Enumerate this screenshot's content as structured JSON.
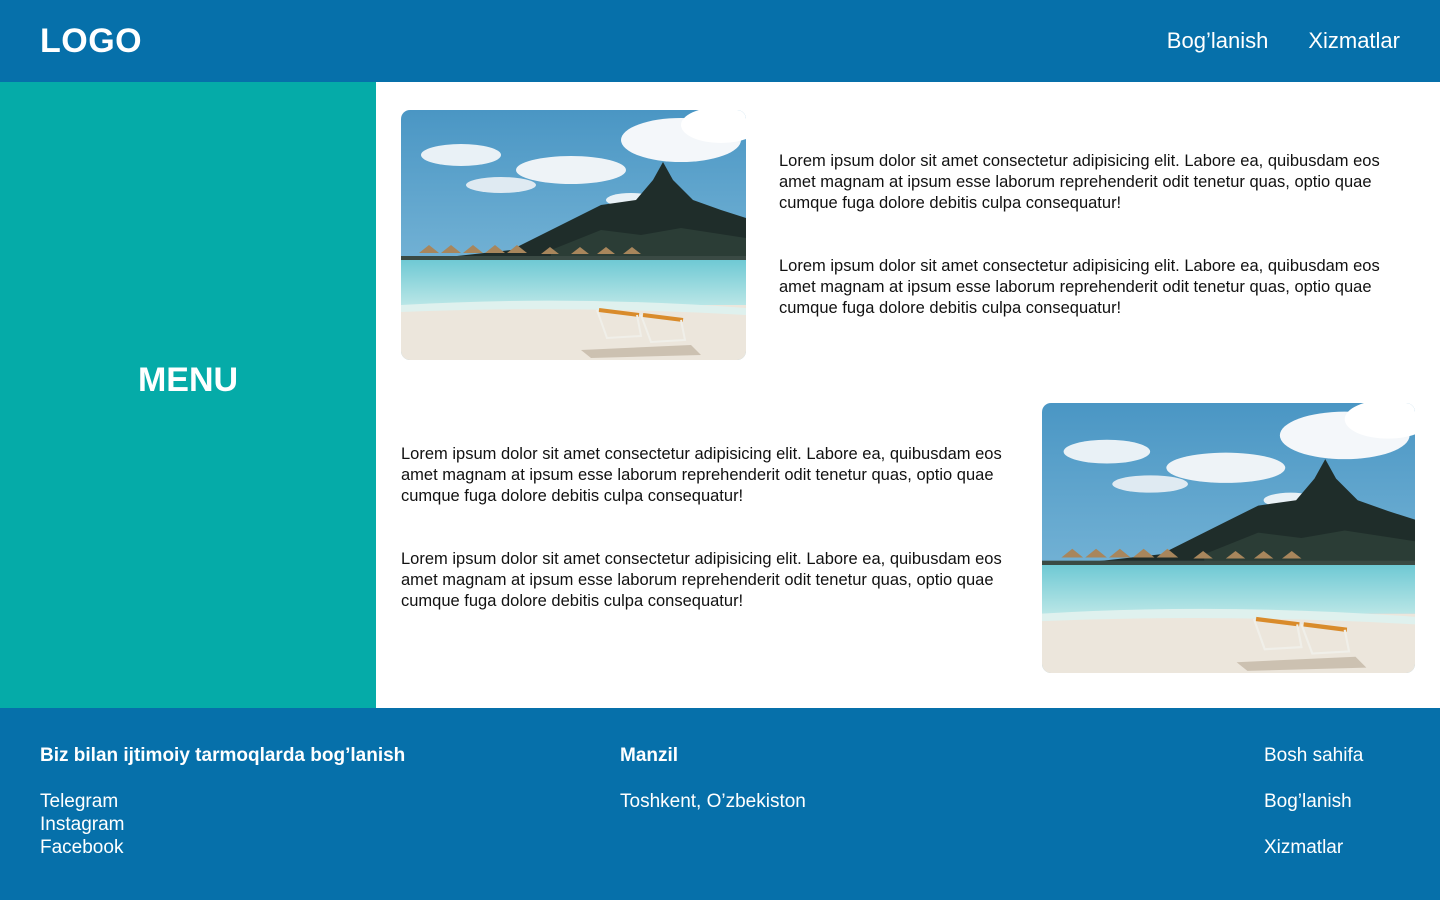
{
  "header": {
    "logo": "LOGO",
    "nav": [
      "Bog’lanish",
      "Xizmatlar"
    ]
  },
  "sidebar": {
    "label": "MENU"
  },
  "main": {
    "section1": {
      "paragraphs": [
        "Lorem ipsum dolor sit amet consectetur adipisicing elit. Labore ea, quibusdam eos amet magnam at ipsum esse laborum reprehenderit odit tenetur quas, optio quae cumque fuga dolore debitis culpa consequatur!",
        "Lorem ipsum dolor sit amet consectetur adipisicing elit. Labore ea, quibusdam eos amet magnam at ipsum esse laborum reprehenderit odit tenetur quas, optio quae cumque fuga dolore debitis culpa consequatur!"
      ]
    },
    "section2": {
      "paragraphs": [
        "Lorem ipsum dolor sit amet consectetur adipisicing elit. Labore ea, quibusdam eos amet magnam at ipsum esse laborum reprehenderit odit tenetur quas, optio quae cumque fuga dolore debitis culpa consequatur!",
        "Lorem ipsum dolor sit amet consectetur adipisicing elit. Labore ea, quibusdam eos amet magnam at ipsum esse laborum reprehenderit odit tenetur quas, optio quae cumque fuga dolore debitis culpa consequatur!"
      ]
    }
  },
  "footer": {
    "social": {
      "heading": "Biz bilan ijtimoiy tarmoqlarda bog’lanish",
      "links": [
        "Telegram",
        "Instagram",
        "Facebook"
      ]
    },
    "address": {
      "heading": "Manzil",
      "value": "Toshkent, O’zbekiston"
    },
    "nav": [
      "Bosh sahifa",
      "Bog’lanish",
      "Xizmatlar"
    ]
  },
  "colors": {
    "header_bg": "#0670aa",
    "sidebar_bg": "#05aba8",
    "footer_bg": "#0670aa"
  }
}
